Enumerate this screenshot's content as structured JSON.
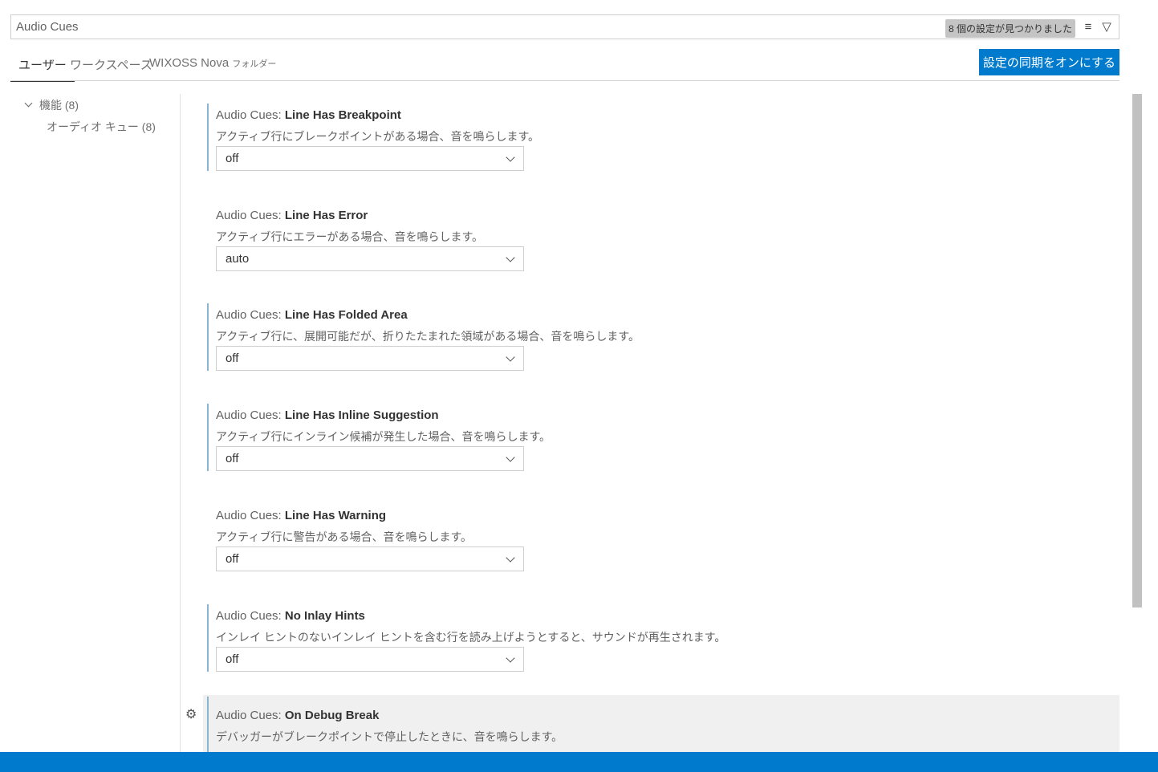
{
  "search": {
    "value": "Audio Cues",
    "result_count": "8 個の設定が見つかりました"
  },
  "tabs": [
    {
      "label": "ユーザー"
    },
    {
      "label": "ワークスペース"
    },
    {
      "label": "WIXOSS Nova",
      "suffix": "フォルダー"
    }
  ],
  "sync_button": "設定の同期をオンにする",
  "toc": [
    {
      "label": "機能 (8)"
    },
    {
      "label": "オーディオ キュー (8)"
    }
  ],
  "settings": [
    {
      "category": "Audio Cues: ",
      "name": "Line Has Breakpoint",
      "description": "アクティブ行にブレークポイントがある場合、音を鳴らします。",
      "value": "off"
    },
    {
      "category": "Audio Cues: ",
      "name": "Line Has Error",
      "description": "アクティブ行にエラーがある場合、音を鳴らします。",
      "value": "auto"
    },
    {
      "category": "Audio Cues: ",
      "name": "Line Has Folded Area",
      "description": "アクティブ行に、展開可能だが、折りたたまれた領域がある場合、音を鳴らします。",
      "value": "off"
    },
    {
      "category": "Audio Cues: ",
      "name": "Line Has Inline Suggestion",
      "description": "アクティブ行にインライン候補が発生した場合、音を鳴らします。",
      "value": "off"
    },
    {
      "category": "Audio Cues: ",
      "name": "Line Has Warning",
      "description": "アクティブ行に警告がある場合、音を鳴らします。",
      "value": "off"
    },
    {
      "category": "Audio Cues: ",
      "name": "No Inlay Hints",
      "description": "インレイ ヒントのないインレイ ヒントを含む行を読み上げようとすると、サウンドが再生されます。",
      "value": "off"
    },
    {
      "category": "Audio Cues: ",
      "name": "On Debug Break",
      "description": "デバッガーがブレークポイントで停止したときに、音を鳴らします。"
    }
  ]
}
